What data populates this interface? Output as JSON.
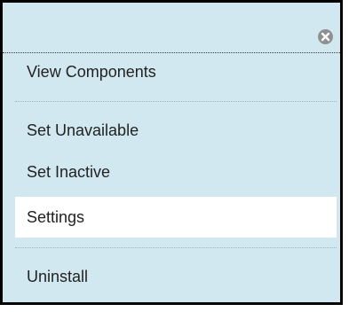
{
  "menu": {
    "close_icon": "close-circle-icon",
    "items": [
      {
        "label": "View Components"
      },
      {
        "label": "Set Unavailable"
      },
      {
        "label": "Set Inactive"
      },
      {
        "label": "Settings",
        "state": "highlighted"
      },
      {
        "label": "Uninstall"
      }
    ]
  },
  "colors": {
    "panel_bg": "#d2e8f0",
    "highlight_bg": "#ffffff",
    "border": "#000000",
    "text": "#222222",
    "close_icon": "#909090"
  }
}
